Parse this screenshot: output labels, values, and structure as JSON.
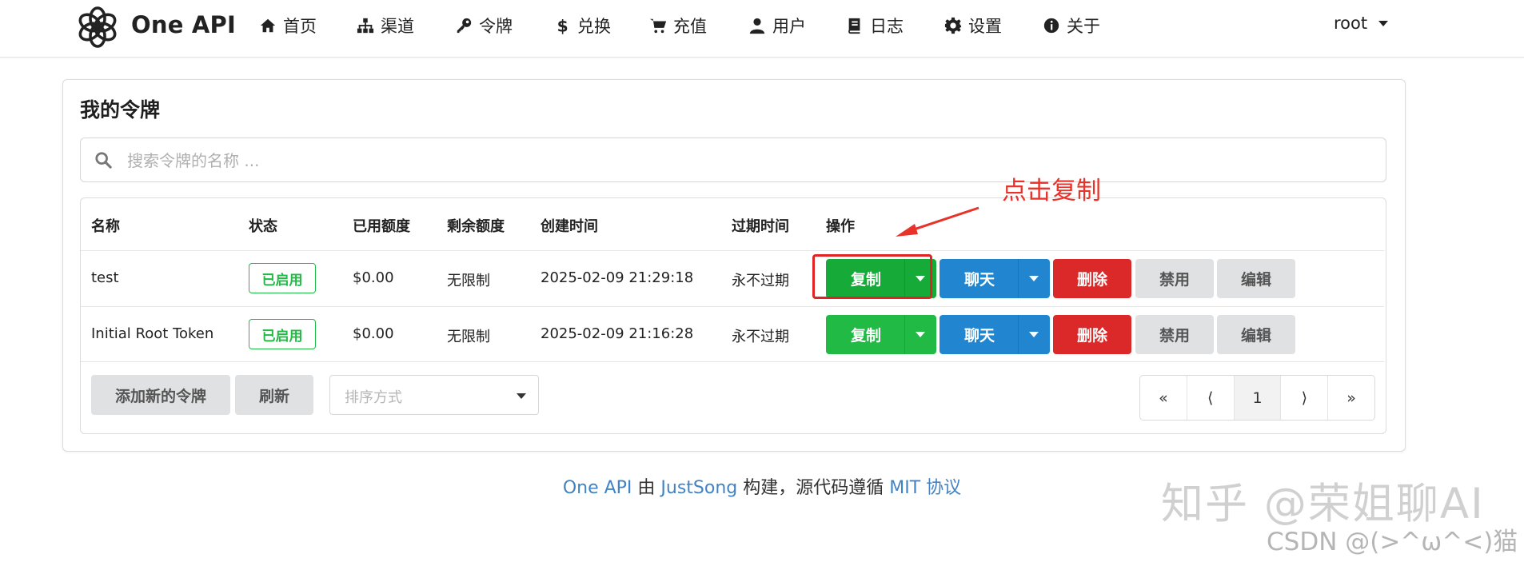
{
  "header": {
    "brand": "One API",
    "nav": [
      {
        "label": "首页",
        "icon": "home-icon"
      },
      {
        "label": "渠道",
        "icon": "sitemap-icon"
      },
      {
        "label": "令牌",
        "icon": "key-icon"
      },
      {
        "label": "兑换",
        "icon": "dollar-icon"
      },
      {
        "label": "充值",
        "icon": "cart-icon"
      },
      {
        "label": "用户",
        "icon": "user-icon"
      },
      {
        "label": "日志",
        "icon": "book-icon"
      },
      {
        "label": "设置",
        "icon": "gear-icon"
      },
      {
        "label": "关于",
        "icon": "info-icon"
      }
    ],
    "user": "root"
  },
  "page": {
    "title": "我的令牌",
    "search_placeholder": "搜索令牌的名称 ..."
  },
  "table": {
    "columns": [
      "名称",
      "状态",
      "已用额度",
      "剩余额度",
      "创建时间",
      "过期时间",
      "操作"
    ],
    "rows": [
      {
        "name": "test",
        "status": "已启用",
        "used": "$0.00",
        "remaining": "无限制",
        "created": "2025-02-09 21:29:18",
        "expires": "永不过期"
      },
      {
        "name": "Initial Root Token",
        "status": "已启用",
        "used": "$0.00",
        "remaining": "无限制",
        "created": "2025-02-09 21:16:28",
        "expires": "永不过期"
      }
    ],
    "actions": {
      "copy": "复制",
      "chat": "聊天",
      "delete": "删除",
      "disable": "禁用",
      "edit": "编辑"
    }
  },
  "toolbar": {
    "add": "添加新的令牌",
    "refresh": "刷新",
    "sort_placeholder": "排序方式"
  },
  "pagination": {
    "first": "«",
    "prev": "⟨",
    "current": "1",
    "next": "⟩",
    "last": "»"
  },
  "annotation": {
    "text": "点击复制",
    "color": "#e8322a"
  },
  "footer": {
    "p1": "One API",
    "p2": " 由 ",
    "p3": "JustSong",
    "p4": " 构建，源代码遵循 ",
    "p5": "MIT 协议"
  },
  "watermarks": {
    "zhihu": "知乎 @荣姐聊AI",
    "csdn": "CSDN @(>^ω^<)猫"
  },
  "colors": {
    "green": "#21ba45",
    "blue": "#2185d0",
    "red": "#db2828",
    "grey": "#e0e1e2",
    "link": "#4183c4"
  }
}
